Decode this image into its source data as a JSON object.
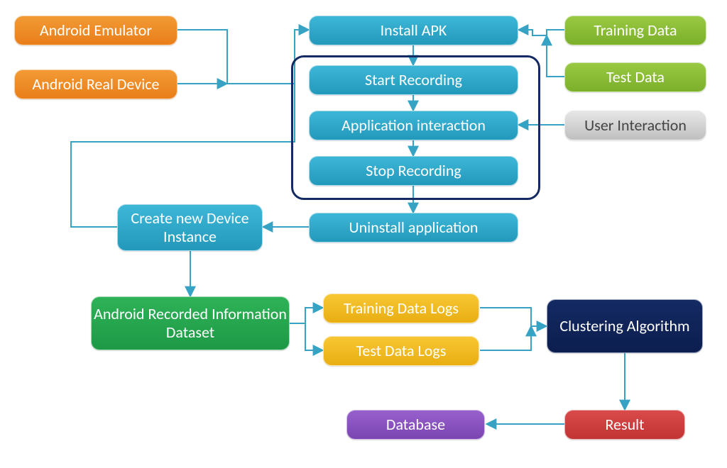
{
  "nodes": {
    "androidEmulator": "Android Emulator",
    "androidRealDevice": "Android Real Device",
    "installAPK": "Install APK",
    "trainingData": "Training Data",
    "testData": "Test Data",
    "startRecording": "Start Recording",
    "appInteraction": "Application interaction",
    "stopRecording": "Stop Recording",
    "uninstallApp": "Uninstall application",
    "userInteraction": "User Interaction",
    "createNewDevice": "Create new Device Instance",
    "recordedDataset": "Android Recorded Information Dataset",
    "trainingLogs": "Training Data Logs",
    "testLogs": "Test Data Logs",
    "clustering": "Clustering Algorithm",
    "result": "Result",
    "database": "Database"
  },
  "edges": [
    [
      "androidEmulator",
      "installAPK"
    ],
    [
      "androidRealDevice",
      "installAPK"
    ],
    [
      "trainingData",
      "installAPK"
    ],
    [
      "testData",
      "installAPK"
    ],
    [
      "installAPK",
      "startRecording"
    ],
    [
      "startRecording",
      "appInteraction"
    ],
    [
      "appInteraction",
      "stopRecording"
    ],
    [
      "stopRecording",
      "uninstallApp"
    ],
    [
      "userInteraction",
      "appInteraction"
    ],
    [
      "uninstallApp",
      "createNewDevice"
    ],
    [
      "createNewDevice",
      "installAPK"
    ],
    [
      "createNewDevice",
      "recordedDataset"
    ],
    [
      "recordedDataset",
      "trainingLogs"
    ],
    [
      "recordedDataset",
      "testLogs"
    ],
    [
      "trainingLogs",
      "clustering"
    ],
    [
      "testLogs",
      "clustering"
    ],
    [
      "clustering",
      "result"
    ],
    [
      "result",
      "database"
    ]
  ],
  "palette": {
    "orange": "#ED8824",
    "cyan": "#2CA6C8",
    "green": "#8ABF35",
    "silver": "#D0D0D0",
    "deepgreen": "#24A64C",
    "gold": "#F0B820",
    "navy": "#0F235A",
    "purple": "#8A52C0",
    "red": "#CF3E3E",
    "arrow": "#36A2C4"
  }
}
